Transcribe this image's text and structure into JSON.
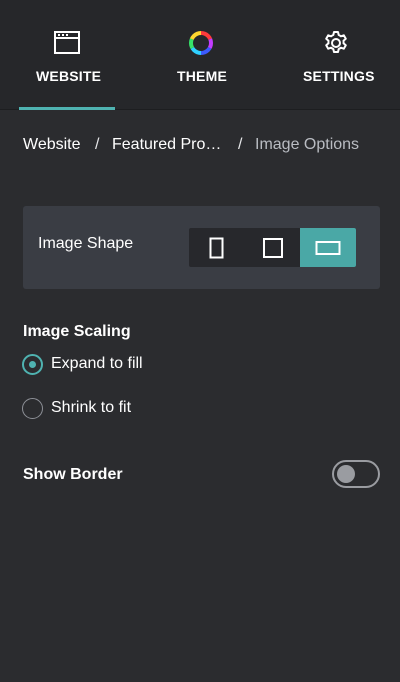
{
  "nav": {
    "tabs": [
      {
        "label": "WEBSITE",
        "icon": "browser-window-icon",
        "active": true
      },
      {
        "label": "THEME",
        "icon": "color-wheel-icon",
        "active": false
      },
      {
        "label": "SETTINGS",
        "icon": "gear-icon",
        "active": false
      }
    ],
    "accent_color": "#4fb3b1"
  },
  "breadcrumb": {
    "items": [
      "Website",
      "Featured Pro…",
      "Image Options"
    ],
    "separator": "/"
  },
  "image_shape": {
    "label": "Image Shape",
    "options": [
      {
        "name": "portrait",
        "icon": "portrait-rect-icon",
        "selected": false
      },
      {
        "name": "square",
        "icon": "square-icon",
        "selected": false
      },
      {
        "name": "landscape",
        "icon": "landscape-rect-icon",
        "selected": true
      }
    ]
  },
  "image_scaling": {
    "title": "Image Scaling",
    "options": [
      {
        "label": "Expand to fill",
        "checked": true
      },
      {
        "label": "Shrink to fit",
        "checked": false
      }
    ]
  },
  "show_border": {
    "label": "Show Border",
    "enabled": false
  }
}
